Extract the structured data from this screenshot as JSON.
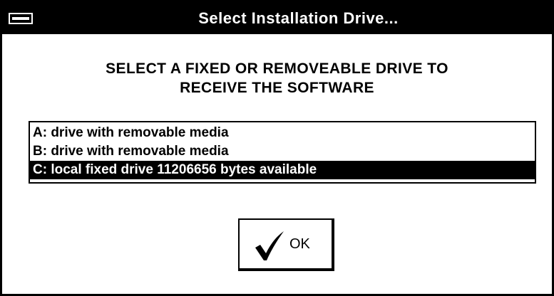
{
  "window": {
    "title": "Select Installation Drive...",
    "system_menu_icon": "system-menu-icon"
  },
  "instructions": {
    "line1": "SELECT A FIXED OR REMOVEABLE DRIVE TO",
    "line2": "RECEIVE THE SOFTWARE"
  },
  "drive_list": {
    "items": [
      {
        "label": "A: drive with removable media",
        "selected": false
      },
      {
        "label": "B: drive with removable media",
        "selected": false
      },
      {
        "label": "C: local fixed drive 11206656 bytes available",
        "selected": true
      }
    ]
  },
  "ok_button": {
    "label": "OK",
    "icon": "checkmark-icon"
  },
  "colors": {
    "titlebar": "#000000",
    "selection": "#000000",
    "background": "#ffffff"
  }
}
